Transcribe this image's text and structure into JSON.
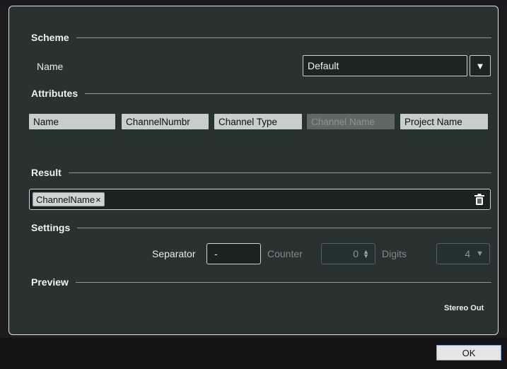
{
  "scheme": {
    "title": "Scheme",
    "name_label": "Name",
    "selected": "Default"
  },
  "attributes": {
    "title": "Attributes",
    "chips": [
      {
        "label": "Name",
        "enabled": true
      },
      {
        "label": "ChannelNumbr",
        "enabled": true
      },
      {
        "label": "Channel Type",
        "enabled": true
      },
      {
        "label": "Channel Name",
        "enabled": false
      },
      {
        "label": "Project Name",
        "enabled": true
      }
    ]
  },
  "result": {
    "title": "Result",
    "tags": [
      {
        "label": "ChannelName",
        "close": "×"
      }
    ]
  },
  "settings": {
    "title": "Settings",
    "separator_label": "Separator",
    "separator_value": "-",
    "counter_label": "Counter",
    "counter_value": "0",
    "digits_label": "Digits",
    "digits_value": "4"
  },
  "preview": {
    "title": "Preview",
    "output": "Stereo Out"
  },
  "footer": {
    "ok_label": "OK"
  }
}
